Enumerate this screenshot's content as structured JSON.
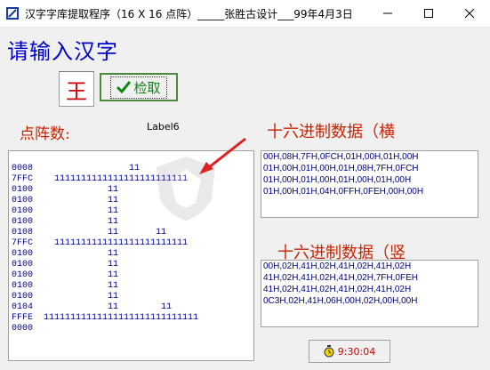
{
  "window": {
    "title": "汉字字库提取程序（16 X 16 点阵）_____张胜古设计___99年4月3日",
    "controls": {
      "minimize": "—",
      "maximize": "☐",
      "close": "✕"
    }
  },
  "prompt": "请输入汉字",
  "input_char": "王",
  "check_button": {
    "label": "检取",
    "icon": "check-icon"
  },
  "dot_matrix_label": "点阵数:",
  "label6": "Label6",
  "hex_horizontal_title": "十六进制数据（横",
  "hex_vertical_title": "十六进制数据（竖",
  "dot_matrix": {
    "rows": [
      {
        "code": "0008",
        "bits": "                  11"
      },
      {
        "code": "7FFC",
        "bits": "    1111111111111111111111111"
      },
      {
        "code": "0100",
        "bits": "              11"
      },
      {
        "code": "0100",
        "bits": "              11"
      },
      {
        "code": "0100",
        "bits": "              11"
      },
      {
        "code": "0100",
        "bits": "              11"
      },
      {
        "code": "0108",
        "bits": "              11       11"
      },
      {
        "code": "7FFC",
        "bits": "    1111111111111111111111111"
      },
      {
        "code": "0100",
        "bits": "              11"
      },
      {
        "code": "0100",
        "bits": "              11"
      },
      {
        "code": "0100",
        "bits": "              11"
      },
      {
        "code": "0100",
        "bits": "              11"
      },
      {
        "code": "0100",
        "bits": "              11"
      },
      {
        "code": "0104",
        "bits": "              11        11"
      },
      {
        "code": "FFFE",
        "bits": "  11111111111111111111111111111"
      },
      {
        "code": "0000",
        "bits": ""
      }
    ]
  },
  "hex_horizontal": [
    "00H,08H,7FH,0FCH,01H,00H,01H,00H",
    "01H,00H,01H,00H,01H,08H,7FH,0FCH",
    "01H,00H,01H,00H,01H,00H,01H,00H",
    "01H,00H,01H,04H,0FFH,0FEH,00H,00H"
  ],
  "hex_vertical": [
    "00H,02H,41H,02H,41H,02H,41H,02H",
    "41H,02H,41H,02H,41H,02H,7FH,0FEH",
    "41H,02H,41H,02H,41H,02H,41H,02H",
    "0C3H,02H,41H,06H,00H,02H,00H,00H"
  ],
  "time_button": {
    "label": "9:30:04",
    "icon": "timer-icon"
  },
  "colors": {
    "prompt": "#0000cc",
    "input_char": "#cc0000",
    "check_label": "#118811",
    "section_titles": "#cc2200",
    "data_text": "#000080",
    "annotation_arrow": "#dd2222"
  }
}
